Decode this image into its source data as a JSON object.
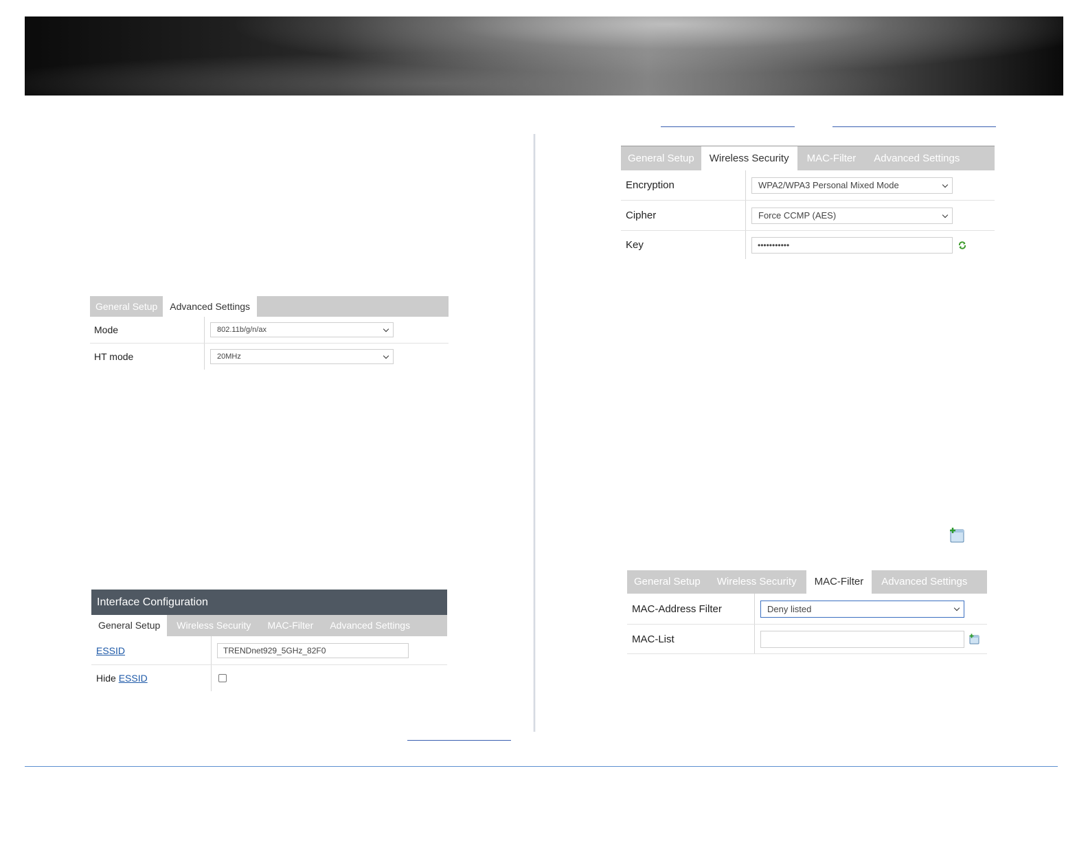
{
  "panel_left_top": {
    "tabs": [
      "General Setup",
      "Advanced Settings"
    ],
    "active_tab": "Advanced Settings",
    "rows": [
      {
        "label": "Mode",
        "value": "802.11b/g/n/ax"
      },
      {
        "label": "HT mode",
        "value": "20MHz"
      }
    ]
  },
  "panel_left_bottom": {
    "header": "Interface Configuration",
    "tabs": [
      "General Setup",
      "Wireless Security",
      "MAC-Filter",
      "Advanced Settings"
    ],
    "active_tab": "General Setup",
    "essid_label": "ESSID",
    "essid_value": "TRENDnet929_5GHz_82F0",
    "hide_label_prefix": "Hide",
    "hide_label_link": "ESSID"
  },
  "panel_right_top": {
    "tabs": [
      "General Setup",
      "Wireless Security",
      "MAC-Filter",
      "Advanced Settings"
    ],
    "active_tab": "Wireless Security",
    "rows": [
      {
        "label": "Encryption",
        "value": "WPA2/WPA3 Personal Mixed Mode"
      },
      {
        "label": "Cipher",
        "value": "Force CCMP (AES)"
      },
      {
        "label": "Key",
        "value": "•••••••••••"
      }
    ]
  },
  "panel_right_bottom": {
    "tabs": [
      "General Setup",
      "Wireless Security",
      "MAC-Filter",
      "Advanced Settings"
    ],
    "active_tab": "MAC-Filter",
    "rows": [
      {
        "label": "MAC-Address Filter",
        "value": "Deny listed"
      },
      {
        "label": "MAC-List",
        "value": ""
      }
    ]
  },
  "icons": {
    "refresh": "refresh-icon",
    "add": "add-entry-icon"
  },
  "colors": {
    "tab_bar": "#cccccc",
    "header_bar": "#4f5862",
    "link": "#1f5aa8",
    "footer_rule": "#5b8fd0"
  }
}
